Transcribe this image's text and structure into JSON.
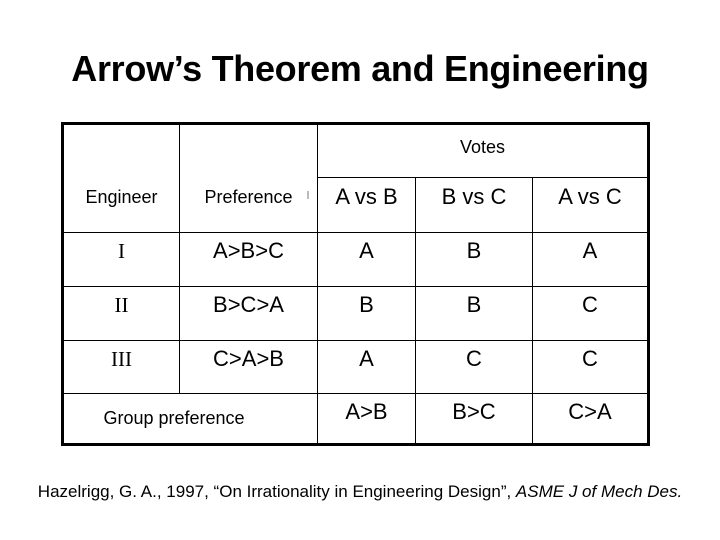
{
  "slide": {
    "title": "Arrow’s Theorem and Engineering",
    "citation": {
      "text": "Hazelrigg, G. A., 1997, “On Irrationality in Engineering Design”, ",
      "journal": "ASME J of Mech Des."
    }
  },
  "table": {
    "headers": {
      "engineer": "Engineer",
      "preference": "Preference",
      "votes": "Votes",
      "matchups": [
        "A vs B",
        "B vs C",
        "A vs C"
      ]
    },
    "rows": [
      {
        "engineer": "I",
        "preference": "A>B>C",
        "votes": [
          "A",
          "B",
          "A"
        ]
      },
      {
        "engineer": "II",
        "preference": "B>C>A",
        "votes": [
          "B",
          "B",
          "C"
        ]
      },
      {
        "engineer": "III",
        "preference": "C>A>B",
        "votes": [
          "A",
          "C",
          "C"
        ]
      }
    ],
    "group": {
      "label": "Group preference",
      "results": [
        "A>B",
        "B>C",
        "C>A"
      ]
    }
  }
}
